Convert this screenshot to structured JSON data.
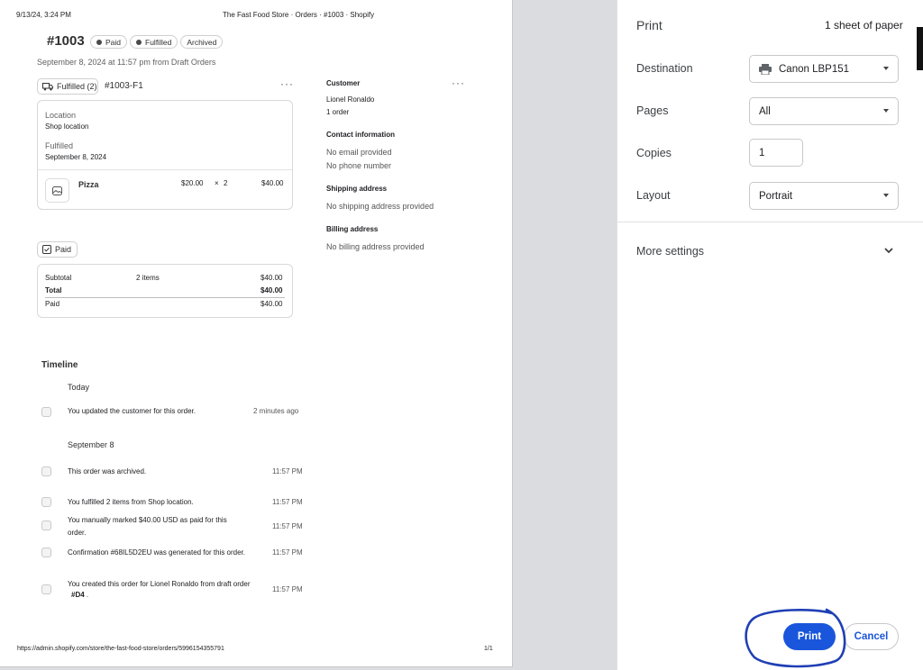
{
  "preview": {
    "header_date": "9/13/24, 3:24 PM",
    "header_title": "The Fast Food Store · Orders · #1003 · Shopify",
    "order_number": "#1003",
    "badges": [
      "Paid",
      "Fulfilled",
      "Archived"
    ],
    "order_meta": "September 8, 2024 at 11:57 pm from Draft Orders",
    "fulfillment": {
      "status_label": "Fulfilled (2)",
      "fulfillment_id": "#1003-F1",
      "location_label": "Location",
      "location_value": "Shop location",
      "fulfilled_label": "Fulfilled",
      "fulfilled_date": "September 8, 2024",
      "item_name": "Pizza",
      "item_price": "$20.00",
      "item_times": "×",
      "item_qty": "2",
      "item_total": "$40.00"
    },
    "payment": {
      "status_label": "Paid",
      "subtotal_label": "Subtotal",
      "subtotal_items": "2 items",
      "subtotal_value": "$40.00",
      "total_label": "Total",
      "total_value": "$40.00",
      "paid_label": "Paid",
      "paid_value": "$40.00"
    },
    "customer": {
      "heading": "Customer",
      "name": "Lionel Ronaldo",
      "orders": "1 order",
      "contact_heading": "Contact information",
      "email": "No email provided",
      "phone": "No phone number",
      "shipping_heading": "Shipping address",
      "shipping": "No shipping address provided",
      "billing_heading": "Billing address",
      "billing": "No billing address provided"
    },
    "timeline": {
      "heading": "Timeline",
      "today_label": "Today",
      "entry_1_text": "You updated the customer for this order.",
      "entry_1_time": "2 minutes ago",
      "date_2_label": "September 8",
      "entry_2_text": "This order was archived.",
      "entry_2_time": "11:57 PM",
      "entry_3_text": "You fulfilled 2 items from Shop location.",
      "entry_3_time": "11:57 PM",
      "entry_4_line1": "You manually marked $40.00 USD as paid for this",
      "entry_4_line2": "order.",
      "entry_4_time": "11:57 PM",
      "entry_5_text": "Confirmation #68IL5D2EU was generated for this order.",
      "entry_5_time": "11:57 PM",
      "entry_6_line1": "You created this order for Lionel Ronaldo from draft order",
      "entry_6_link": "#D4",
      "entry_6_end": ".",
      "entry_6_time": "11:57 PM"
    },
    "footer_url": "https://admin.shopify.com/store/the-fast-food-store/orders/5996154355791",
    "footer_page": "1/1"
  },
  "print_panel": {
    "title": "Print",
    "sheet_count": "1 sheet of paper",
    "destination_label": "Destination",
    "destination_value": "Canon LBP151",
    "pages_label": "Pages",
    "pages_value": "All",
    "copies_label": "Copies",
    "copies_value": "1",
    "layout_label": "Layout",
    "layout_value": "Portrait",
    "more_settings_label": "More settings",
    "print_button": "Print",
    "cancel_button": "Cancel",
    "accent_color": "#1a56db",
    "annotation_color": "#1f3fb5"
  }
}
